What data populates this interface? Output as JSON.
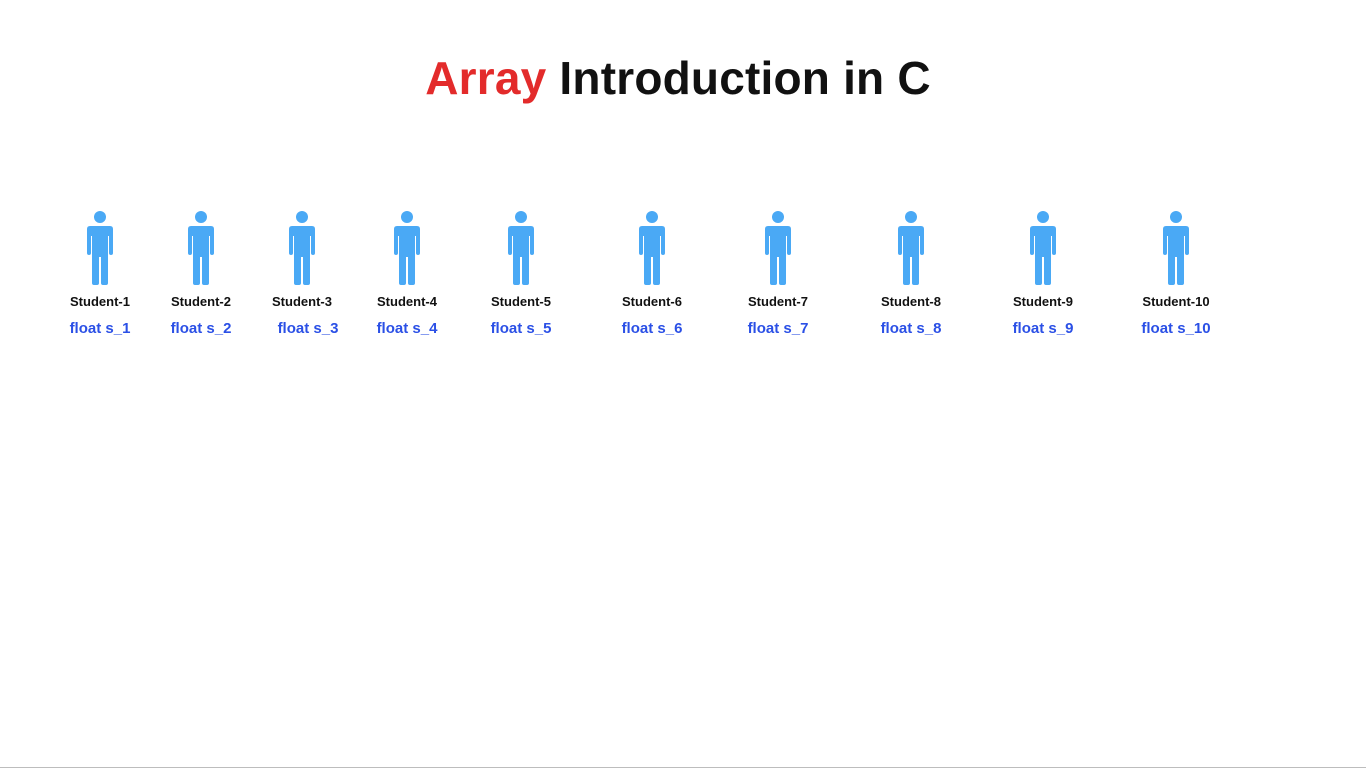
{
  "slide": {
    "title_accent": "Array",
    "title_rest": " Introduction in C",
    "person_icon": "person-icon",
    "icon_color": "#4aa9f5",
    "accent_color": "#e32b2b",
    "var_color": "#2b50e6",
    "students": [
      {
        "name": "Student-1",
        "var": "float s_1"
      },
      {
        "name": "Student-2",
        "var": "float s_2"
      },
      {
        "name": "Student-3",
        "var": "float s_3"
      },
      {
        "name": "Student-4",
        "var": "float s_4"
      },
      {
        "name": "Student-5",
        "var": "float s_5"
      },
      {
        "name": "Student-6",
        "var": "float s_6"
      },
      {
        "name": "Student-7",
        "var": "float s_7"
      },
      {
        "name": "Student-8",
        "var": "float s_8"
      },
      {
        "name": "Student-9",
        "var": "float s_9"
      },
      {
        "name": "Student-10",
        "var": "float s_10"
      }
    ]
  }
}
